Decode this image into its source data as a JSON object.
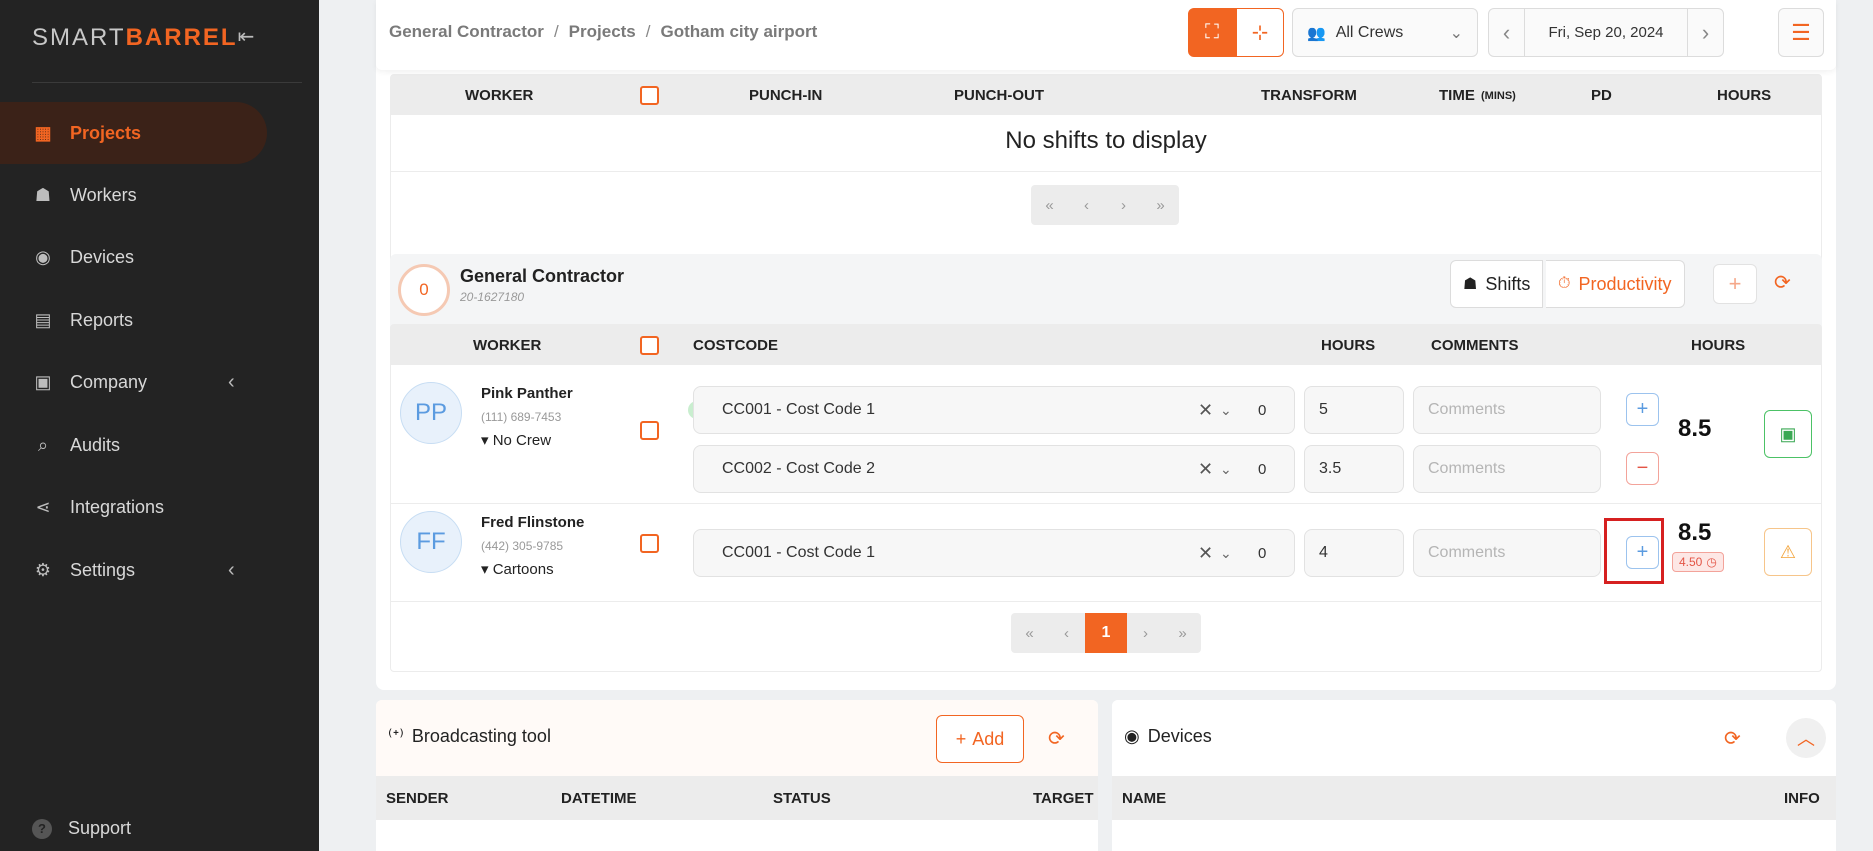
{
  "brand": {
    "smart": "SMART",
    "barrel": "BARREL"
  },
  "sidebar": {
    "items": [
      {
        "label": "Projects",
        "icon": "buildings-icon",
        "glyph": "▦"
      },
      {
        "label": "Workers",
        "icon": "worker-icon",
        "glyph": "☗"
      },
      {
        "label": "Devices",
        "icon": "aperture-icon",
        "glyph": "◉"
      },
      {
        "label": "Reports",
        "icon": "report-icon",
        "glyph": "▤"
      },
      {
        "label": "Company",
        "icon": "briefcase-icon",
        "glyph": "▣"
      },
      {
        "label": "Audits",
        "icon": "audit-icon",
        "glyph": "⌕"
      },
      {
        "label": "Integrations",
        "icon": "share-icon",
        "glyph": "⋖"
      },
      {
        "label": "Settings",
        "icon": "gear-icon",
        "glyph": "⚙"
      }
    ],
    "support": "Support"
  },
  "header": {
    "breadcrumb": [
      "General Contractor",
      "Projects",
      "Gotham city airport"
    ],
    "crew_filter": "All Crews",
    "date": "Fri, Sep 20, 2024"
  },
  "shift_table": {
    "columns": {
      "worker": "WORKER",
      "punch_in": "PUNCH-IN",
      "punch_out": "PUNCH-OUT",
      "transform": "TRANSFORM",
      "time": "TIME",
      "time_unit": "(MINS)",
      "pd": "PD",
      "hours": "HOURS"
    },
    "empty_text": "No shifts to display",
    "pager": [
      "«",
      "‹",
      "›",
      "»"
    ]
  },
  "company_section": {
    "count": "0",
    "name": "General Contractor",
    "license": "20-1627180",
    "tabs": {
      "shifts": "Shifts",
      "productivity": "Productivity"
    },
    "columns": {
      "worker": "WORKER",
      "costcode": "COSTCODE",
      "hours": "HOURS",
      "comments": "COMMENTS",
      "total_hours": "HOURS"
    },
    "comments_placeholder": "Comments",
    "workers": [
      {
        "initials": "PP",
        "name": "Pink Panther",
        "phone": "(111) 689-7453",
        "crew": "No Crew",
        "entries": [
          {
            "costcode": "CC001 - Cost Code 1",
            "count": "0",
            "hours": "5"
          },
          {
            "costcode": "CC002 - Cost Code 2",
            "count": "0",
            "hours": "3.5"
          }
        ],
        "total": "8.5"
      },
      {
        "initials": "FF",
        "name": "Fred Flinstone",
        "phone": "(442) 305-9785",
        "crew": "Cartoons",
        "entries": [
          {
            "costcode": "CC001 - Cost Code 1",
            "count": "0",
            "hours": "4"
          }
        ],
        "total": "8.5",
        "badge": "4.50"
      }
    ],
    "pager": {
      "first": "«",
      "prev": "‹",
      "current": "1",
      "next": "›",
      "last": "»"
    }
  },
  "broadcast": {
    "title": "Broadcasting tool",
    "add_label": "Add",
    "columns": [
      "SENDER",
      "DATETIME",
      "STATUS",
      "TARGET"
    ]
  },
  "devices_panel": {
    "title": "Devices",
    "columns": [
      "NAME",
      "INFO"
    ]
  },
  "colors": {
    "accent": "#f26522",
    "sidebar": "#232323",
    "highlight": "#d62020"
  }
}
